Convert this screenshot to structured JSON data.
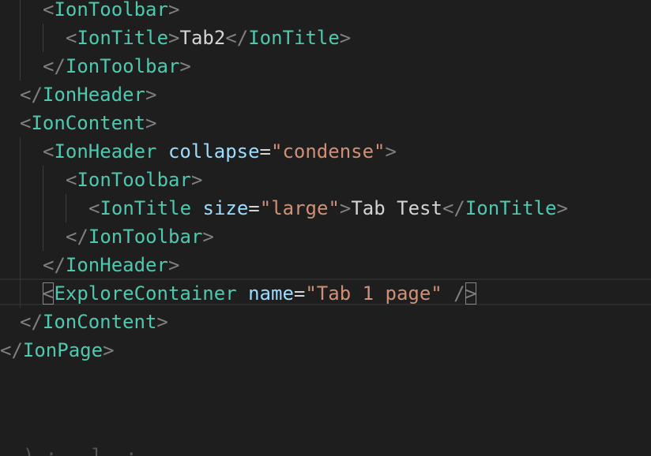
{
  "editor": {
    "language": "tsx",
    "theme": "dark",
    "lines": [
      {
        "segments": [
          {
            "t": "<",
            "c": "bracket"
          },
          {
            "t": "IonToolbar",
            "c": "tag"
          },
          {
            "t": ">",
            "c": "bracket"
          }
        ]
      },
      {
        "segments": [
          {
            "t": "<",
            "c": "bracket"
          },
          {
            "t": "IonTitle",
            "c": "tag"
          },
          {
            "t": ">",
            "c": "bracket"
          },
          {
            "t": "Tab2",
            "c": "text"
          },
          {
            "t": "</",
            "c": "bracket"
          },
          {
            "t": "IonTitle",
            "c": "tag"
          },
          {
            "t": ">",
            "c": "bracket"
          }
        ]
      },
      {
        "segments": [
          {
            "t": "</",
            "c": "bracket"
          },
          {
            "t": "IonToolbar",
            "c": "tag"
          },
          {
            "t": ">",
            "c": "bracket"
          }
        ]
      },
      {
        "segments": [
          {
            "t": "</",
            "c": "bracket"
          },
          {
            "t": "IonHeader",
            "c": "tag"
          },
          {
            "t": ">",
            "c": "bracket"
          }
        ]
      },
      {
        "segments": [
          {
            "t": "<",
            "c": "bracket"
          },
          {
            "t": "IonContent",
            "c": "tag"
          },
          {
            "t": ">",
            "c": "bracket"
          }
        ]
      },
      {
        "segments": [
          {
            "t": "<",
            "c": "bracket"
          },
          {
            "t": "IonHeader",
            "c": "tag"
          },
          {
            "t": " ",
            "c": "text"
          },
          {
            "t": "collapse",
            "c": "attr"
          },
          {
            "t": "=",
            "c": "eq"
          },
          {
            "t": "\"condense\"",
            "c": "str"
          },
          {
            "t": ">",
            "c": "bracket"
          }
        ]
      },
      {
        "segments": [
          {
            "t": "<",
            "c": "bracket"
          },
          {
            "t": "IonToolbar",
            "c": "tag"
          },
          {
            "t": ">",
            "c": "bracket"
          }
        ]
      },
      {
        "segments": [
          {
            "t": "<",
            "c": "bracket"
          },
          {
            "t": "IonTitle",
            "c": "tag"
          },
          {
            "t": " ",
            "c": "text"
          },
          {
            "t": "size",
            "c": "attr"
          },
          {
            "t": "=",
            "c": "eq"
          },
          {
            "t": "\"large\"",
            "c": "str"
          },
          {
            "t": ">",
            "c": "bracket"
          },
          {
            "t": "Tab Test",
            "c": "text"
          },
          {
            "t": "</",
            "c": "bracket"
          },
          {
            "t": "IonTitle",
            "c": "tag"
          },
          {
            "t": ">",
            "c": "bracket"
          }
        ]
      },
      {
        "segments": [
          {
            "t": "</",
            "c": "bracket"
          },
          {
            "t": "IonToolbar",
            "c": "tag"
          },
          {
            "t": ">",
            "c": "bracket"
          }
        ]
      },
      {
        "segments": [
          {
            "t": "</",
            "c": "bracket"
          },
          {
            "t": "IonHeader",
            "c": "tag"
          },
          {
            "t": ">",
            "c": "bracket"
          }
        ]
      },
      {
        "segments": [
          {
            "t": "<",
            "c": "bracket",
            "match": true
          },
          {
            "t": "ExploreContainer",
            "c": "tag"
          },
          {
            "t": " ",
            "c": "text"
          },
          {
            "t": "name",
            "c": "attr"
          },
          {
            "t": "=",
            "c": "eq"
          },
          {
            "t": "\"Tab 1 page\"",
            "c": "str"
          },
          {
            "t": " /",
            "c": "bracket"
          },
          {
            "t": ">",
            "c": "bracket",
            "match": true
          }
        ],
        "current": true
      },
      {
        "segments": [
          {
            "t": "</",
            "c": "bracket"
          },
          {
            "t": "IonContent",
            "c": "tag"
          },
          {
            "t": ">",
            "c": "bracket"
          }
        ]
      },
      {
        "segments": [
          {
            "t": "</",
            "c": "bracket"
          },
          {
            "t": "IonPage",
            "c": "tag"
          },
          {
            "t": ">",
            "c": "bracket"
          }
        ]
      }
    ],
    "faded_fragment": "  ) ;   l  ;"
  }
}
